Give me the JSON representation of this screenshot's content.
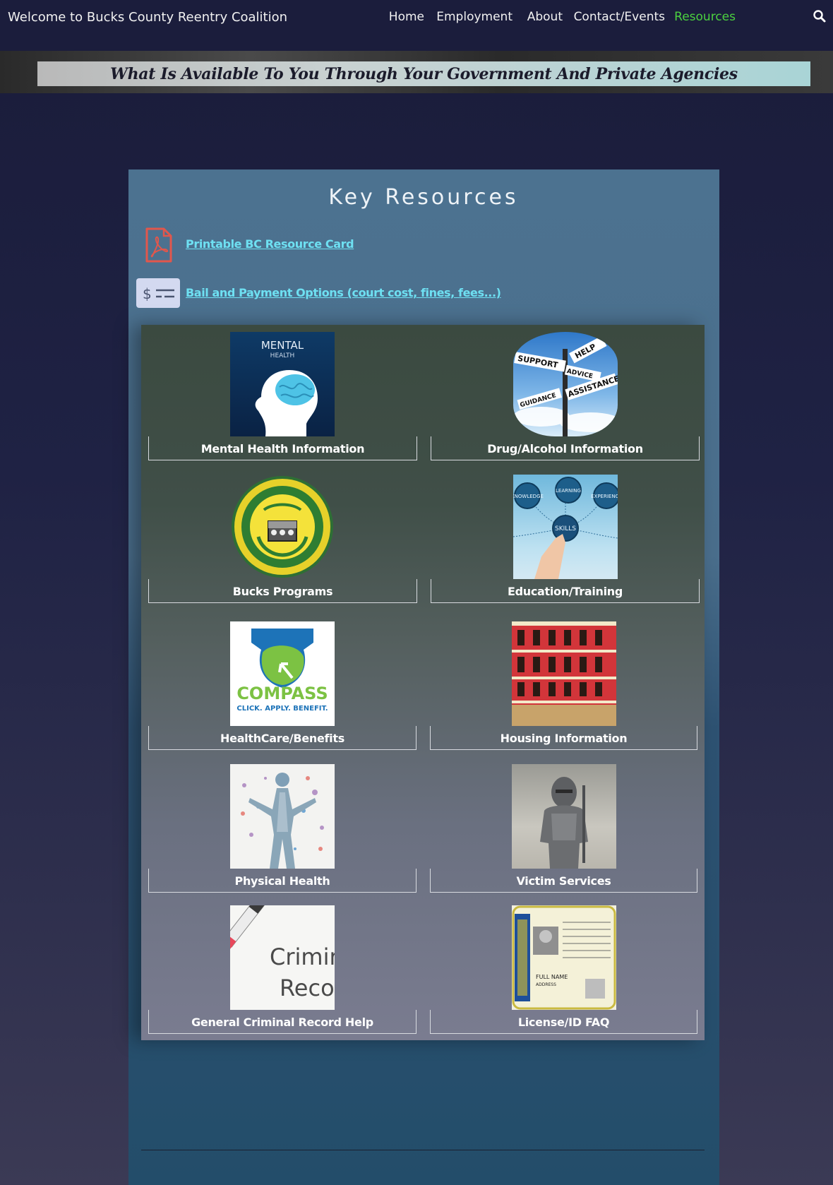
{
  "nav": {
    "site_title": "Welcome to Bucks County Reentry Coalition",
    "items": [
      {
        "label": "Home",
        "active": false
      },
      {
        "label": "Employment",
        "active": false
      },
      {
        "label": "About",
        "active": false
      },
      {
        "label": "Contact/Events",
        "active": false
      },
      {
        "label": "Resources",
        "active": true
      }
    ],
    "search_icon": "search-icon",
    "active_color": "#4bd13f"
  },
  "banner": {
    "text": "What Is Available To You Through Your Government And Private Agencies"
  },
  "panel": {
    "title": "Key Resources",
    "links": [
      {
        "label": "Printable BC Resource Card",
        "icon": "pdf-icon"
      },
      {
        "label": "Bail and Payment Options (court cost, fines, fees...)",
        "icon": "payment-icon"
      }
    ]
  },
  "cards": [
    {
      "label": "Mental Health Information",
      "image": "mental-health-image",
      "image_text": "MENTAL",
      "image_subtext": "HEALTH"
    },
    {
      "label": "Drug/Alcohol Information",
      "image": "signpost-image",
      "signs": [
        "HELP",
        "SUPPORT",
        "ADVICE",
        "ASSISTANCE",
        "GUIDANCE"
      ]
    },
    {
      "label": "Bucks Programs",
      "image": "county-seal-image"
    },
    {
      "label": "Education/Training",
      "image": "skills-image",
      "bubbles": [
        "KNOWLEDGE",
        "LEARNING",
        "EXPERIENCE",
        "SKILLS"
      ]
    },
    {
      "label": "HealthCare/Benefits",
      "image": "compass-logo-image",
      "image_text": "COMPASS",
      "image_subtext": "CLICK. APPLY. BENEFIT."
    },
    {
      "label": "Housing Information",
      "image": "building-image"
    },
    {
      "label": "Physical Health",
      "image": "body-image"
    },
    {
      "label": "Victim Services",
      "image": "knight-image"
    },
    {
      "label": "General Criminal Record Help",
      "image": "criminal-record-image",
      "image_text": "Crimir",
      "image_subtext": "Recoi"
    },
    {
      "label": "License/ID FAQ",
      "image": "license-image",
      "image_text": "FULL NAME",
      "image_subtext": "ADDRESS"
    }
  ],
  "colors": {
    "link": "#6ee0f2",
    "panel_top": "#4c7290",
    "panel_bottom": "#234d6a",
    "nav_bg": "#1b1d3c"
  }
}
